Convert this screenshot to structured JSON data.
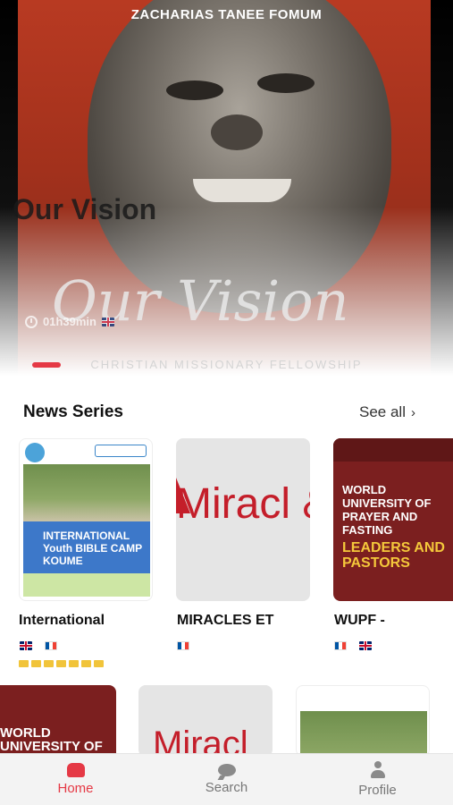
{
  "hero": {
    "author": "ZACHARIAS TANEE FOMUM",
    "title": "Our Vision",
    "script_title": "Our Vision",
    "duration": "01h39min",
    "subtitle": "CHRISTIAN MISSIONARY FELLOWSHIP",
    "language_flag": "flag-uk"
  },
  "news": {
    "section_title": "News Series",
    "see_all": "See all",
    "cards": [
      {
        "title": "International",
        "art_text": "INTERNATIONAL Youth BIBLE CAMP KOUME",
        "flags": [
          "flag-uk",
          "flag-fr"
        ]
      },
      {
        "title": "MIRACLES ET",
        "art_text": "Miracl & Prof",
        "flags": [
          "flag-fr"
        ]
      },
      {
        "title": "WUPF -",
        "art_text": "WORLD UNIVERSITY OF PRAYER AND FASTING",
        "art_text2": "LEADERS AND PASTORS",
        "flags": [
          "flag-fr",
          "flag-uk"
        ]
      }
    ],
    "row2": [
      {
        "art_text": "WORLD UNIVERSITY OF"
      },
      {
        "art_text": "Miracl"
      },
      {
        "art_text": ""
      }
    ]
  },
  "nav": {
    "home": "Home",
    "search": "Search",
    "profile": "Profile",
    "active": "home"
  },
  "colors": {
    "accent": "#e53945",
    "hero_red": "#b83a22",
    "wupf_maroon": "#7b1f1f"
  }
}
